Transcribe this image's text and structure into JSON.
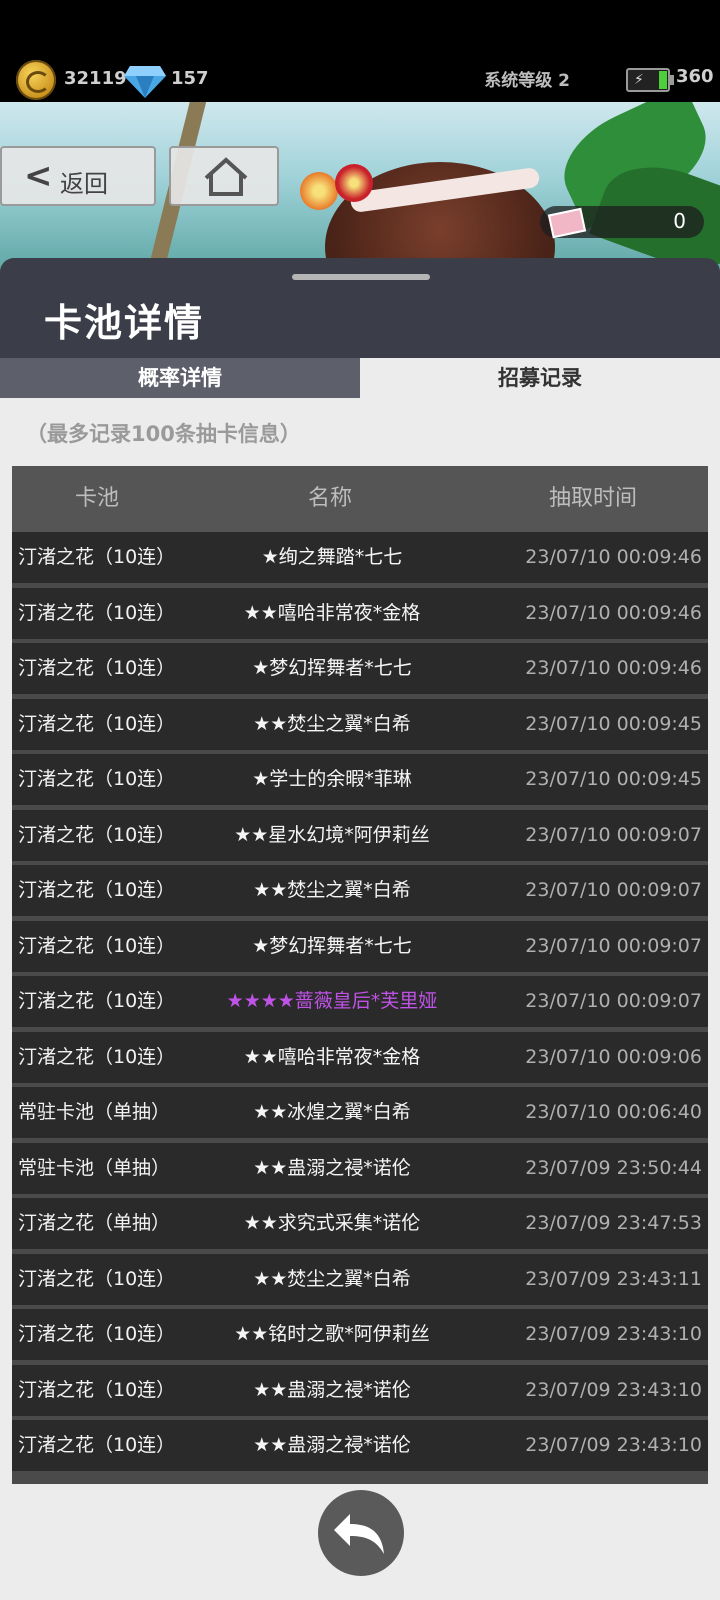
{
  "status": {
    "coins": "32119",
    "gems": "157",
    "system_level": "系统等级 2",
    "energy": "360"
  },
  "nav": {
    "back_label": "返回",
    "ticket_count": "0"
  },
  "panel": {
    "title": "卡池详情",
    "tabs": [
      "概率详情",
      "招募记录"
    ],
    "active_tab": "招募记录",
    "note": "（最多记录100条抽卡信息）"
  },
  "table": {
    "headers": [
      "卡池",
      "名称",
      "抽取时间"
    ],
    "rows": [
      {
        "pool": "汀渚之花（10连）",
        "name": "★绚之舞踏*七七",
        "time": "23/07/10 00:09:46"
      },
      {
        "pool": "汀渚之花（10连）",
        "name": "★★嘻哈非常夜*金格",
        "time": "23/07/10 00:09:46"
      },
      {
        "pool": "汀渚之花（10连）",
        "name": "★梦幻挥舞者*七七",
        "time": "23/07/10 00:09:46"
      },
      {
        "pool": "汀渚之花（10连）",
        "name": "★★焚尘之翼*白希",
        "time": "23/07/10 00:09:45"
      },
      {
        "pool": "汀渚之花（10连）",
        "name": "★学士的余暇*菲琳",
        "time": "23/07/10 00:09:45"
      },
      {
        "pool": "汀渚之花（10连）",
        "name": "★★星水幻境*阿伊莉丝",
        "time": "23/07/10 00:09:07"
      },
      {
        "pool": "汀渚之花（10连）",
        "name": "★★焚尘之翼*白希",
        "time": "23/07/10 00:09:07"
      },
      {
        "pool": "汀渚之花（10连）",
        "name": "★梦幻挥舞者*七七",
        "time": "23/07/10 00:09:07"
      },
      {
        "pool": "汀渚之花（10连）",
        "name": "★★★★蔷薇皇后*芙里娅",
        "time": "23/07/10 00:09:07",
        "rare": true
      },
      {
        "pool": "汀渚之花（10连）",
        "name": "★★嘻哈非常夜*金格",
        "time": "23/07/10 00:09:06"
      },
      {
        "pool": "常驻卡池（单抽）",
        "name": "★★冰煌之翼*白希",
        "time": "23/07/10 00:06:40"
      },
      {
        "pool": "常驻卡池（单抽）",
        "name": "★★蛊溺之祲*诺伦",
        "time": "23/07/09 23:50:44"
      },
      {
        "pool": "汀渚之花（单抽）",
        "name": "★★求究式采集*诺伦",
        "time": "23/07/09 23:47:53"
      },
      {
        "pool": "汀渚之花（10连）",
        "name": "★★焚尘之翼*白希",
        "time": "23/07/09 23:43:11"
      },
      {
        "pool": "汀渚之花（10连）",
        "name": "★★铭时之歌*阿伊莉丝",
        "time": "23/07/09 23:43:10"
      },
      {
        "pool": "汀渚之花（10连）",
        "name": "★★蛊溺之祲*诺伦",
        "time": "23/07/09 23:43:10"
      },
      {
        "pool": "汀渚之花（10连）",
        "name": "★★蛊溺之祲*诺伦",
        "time": "23/07/09 23:43:10"
      }
    ]
  },
  "colors": {
    "rare_highlight": "#c052e8",
    "row_bg": "#2a2a2a",
    "header_bg": "#3b3d48"
  }
}
